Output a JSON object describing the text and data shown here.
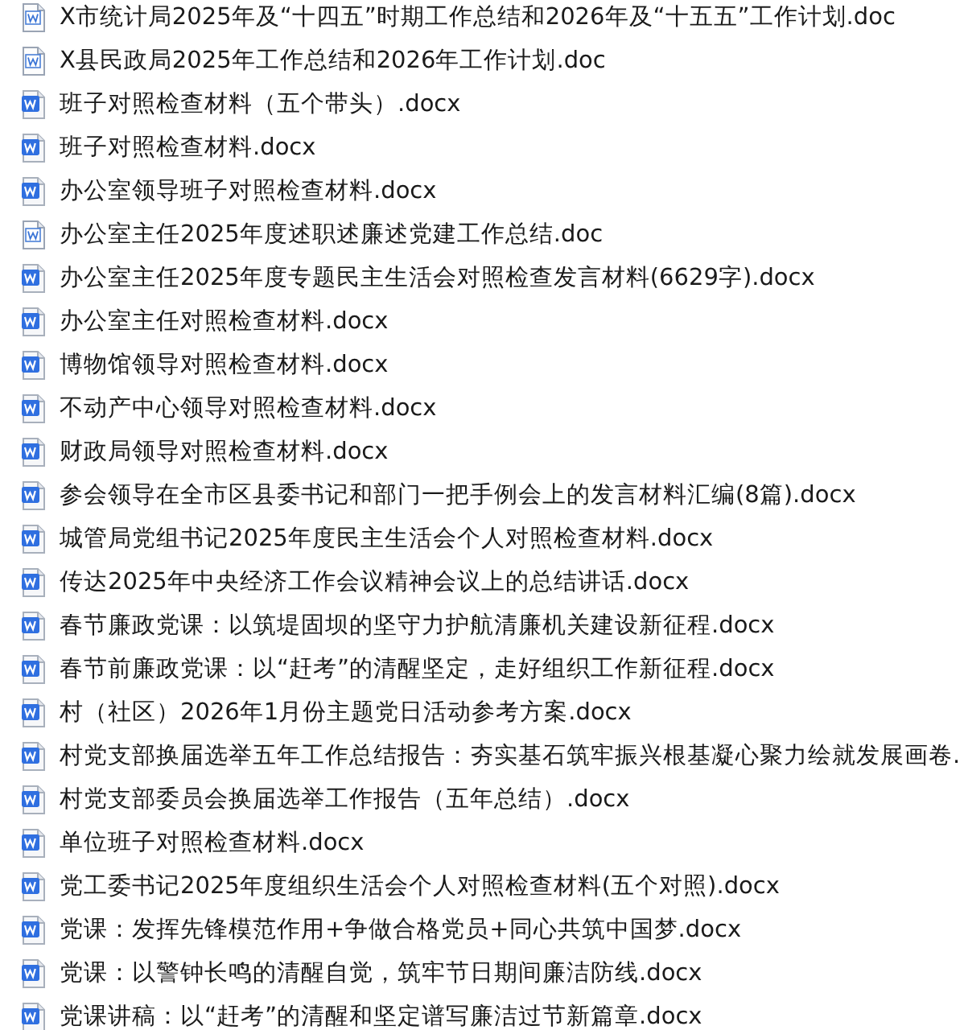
{
  "files": [
    {
      "name": "X市统计局2025年及“十四五”时期工作总结和2026年及“十五五”工作计划.doc",
      "kind": "doc"
    },
    {
      "name": "X县民政局2025年工作总结和2026年工作计划.doc",
      "kind": "doc"
    },
    {
      "name": "班子对照检查材料（五个带头）.docx",
      "kind": "docx"
    },
    {
      "name": "班子对照检查材料.docx",
      "kind": "docx"
    },
    {
      "name": "办公室领导班子对照检查材料.docx",
      "kind": "docx"
    },
    {
      "name": "办公室主任2025年度述职述廉述党建工作总结.doc",
      "kind": "doc"
    },
    {
      "name": "办公室主任2025年度专题民主生活会对照检查发言材料(6629字).docx",
      "kind": "docx"
    },
    {
      "name": "办公室主任对照检查材料.docx",
      "kind": "docx"
    },
    {
      "name": "博物馆领导对照检查材料.docx",
      "kind": "docx"
    },
    {
      "name": "不动产中心领导对照检查材料.docx",
      "kind": "docx"
    },
    {
      "name": "财政局领导对照检查材料.docx",
      "kind": "docx"
    },
    {
      "name": "参会领导在全市区县委书记和部门一把手例会上的发言材料汇编(8篇).docx",
      "kind": "docx"
    },
    {
      "name": "城管局党组书记2025年度民主生活会个人对照检查材料.docx",
      "kind": "docx"
    },
    {
      "name": "传达2025年中央经济工作会议精神会议上的总结讲话.docx",
      "kind": "docx"
    },
    {
      "name": "春节廉政党课：以筑堤固坝的坚守力护航清廉机关建设新征程.docx",
      "kind": "docx"
    },
    {
      "name": "春节前廉政党课：以“赶考”的清醒坚定，走好组织工作新征程.docx",
      "kind": "docx"
    },
    {
      "name": "村（社区）2026年1月份主题党日活动参考方案.docx",
      "kind": "docx"
    },
    {
      "name": "村党支部换届选举五年工作总结报告：夯实基石筑牢振兴根基凝心聚力绘就发展画卷.",
      "kind": "docx"
    },
    {
      "name": "村党支部委员会换届选举工作报告（五年总结）.docx",
      "kind": "docx"
    },
    {
      "name": "单位班子对照检查材料.docx",
      "kind": "docx"
    },
    {
      "name": "党工委书记2025年度组织生活会个人对照检查材料(五个对照).docx",
      "kind": "docx"
    },
    {
      "name": "党课：发挥先锋模范作用+争做合格党员+同心共筑中国梦.docx",
      "kind": "docx"
    },
    {
      "name": "党课：以警钟长鸣的清醒自觉，筑牢节日期间廉洁防线.docx",
      "kind": "docx"
    },
    {
      "name": "党课讲稿：以“赶考”的清醒和坚定谱写廉洁过节新篇章.docx",
      "kind": "docx"
    }
  ]
}
